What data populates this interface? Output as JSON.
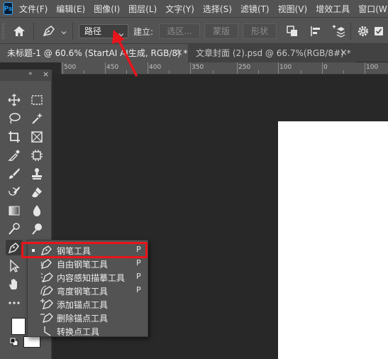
{
  "app": {
    "logo": "Ps"
  },
  "menu": [
    "文件(F)",
    "编辑(E)",
    "图像(I)",
    "图层(L)",
    "文字(Y)",
    "选择(S)",
    "滤镜(T)",
    "视图(V)",
    "增效工具",
    "窗口(W)"
  ],
  "options": {
    "mode_value": "路径",
    "make_label": "建立:",
    "selection_btn": "选区...",
    "mask_btn": "蒙版",
    "shape_btn": "形状"
  },
  "tabs": [
    {
      "label": "未标题-1 @ 60.6% (StartAI AI生成, RGB/8) *",
      "close": "×"
    },
    {
      "label": "文章封面 (2).psd @ 66.7%(RGB/8#) *",
      "close": "×"
    }
  ],
  "ruler": [
    "500",
    "450",
    "400",
    "350",
    "300",
    "250",
    "200",
    "150",
    "100",
    "50",
    "0",
    "50",
    "100",
    "150"
  ],
  "toolpanel": {
    "collapse": "«",
    "close": "×",
    "more": "•••"
  },
  "flyout": [
    {
      "label": "钢笔工具",
      "key": "P",
      "icon": "pen-icon",
      "active": true
    },
    {
      "label": "自由钢笔工具",
      "key": "P",
      "icon": "freeform-pen-icon"
    },
    {
      "label": "内容感知描摹工具",
      "key": "P",
      "icon": "content-aware-tracing-icon"
    },
    {
      "label": "弯度钢笔工具",
      "key": "P",
      "icon": "curvature-pen-icon"
    },
    {
      "label": "添加锚点工具",
      "key": "",
      "icon": "add-anchor-icon"
    },
    {
      "label": "删除锚点工具",
      "key": "",
      "icon": "delete-anchor-icon"
    },
    {
      "label": "转换点工具",
      "key": "",
      "icon": "convert-point-icon"
    }
  ],
  "colors": {
    "accent": "#31a8ff",
    "highlight": "#e8151b",
    "canvas": "#282828",
    "panel": "#535353"
  }
}
